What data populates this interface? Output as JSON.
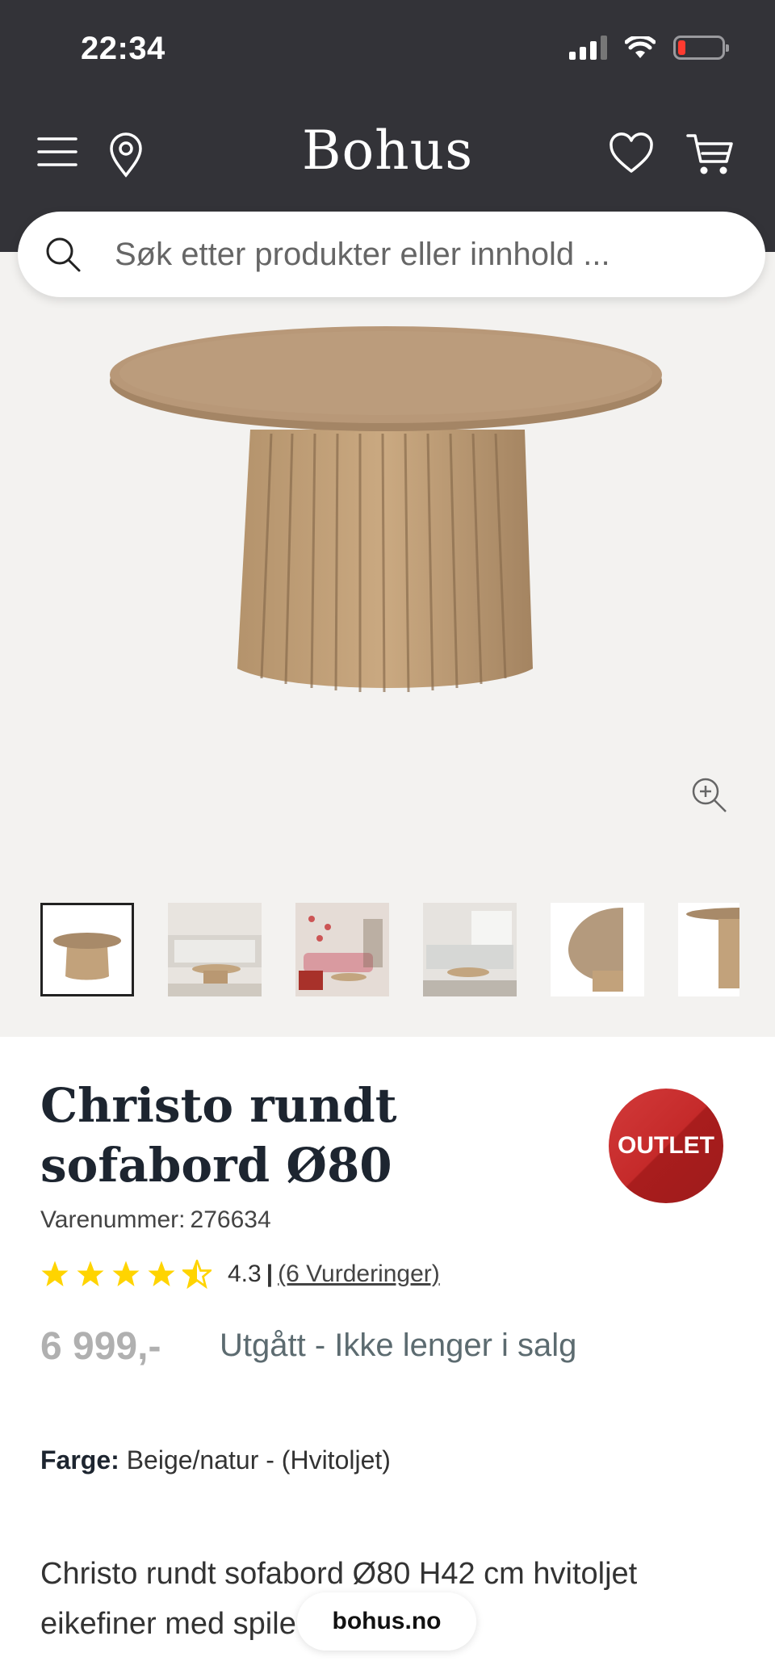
{
  "status_bar": {
    "time": "22:34"
  },
  "header": {
    "logo": "Bohus",
    "icons": [
      "menu-icon",
      "location-pin-icon",
      "heart-icon",
      "cart-icon"
    ]
  },
  "search": {
    "placeholder": "Søk etter produkter eller innhold ..."
  },
  "gallery": {
    "thumbnails": [
      "Christo table product",
      "Living room scene",
      "Pink sofa scene",
      "Grey sofa scene",
      "Tabletop close-up",
      "Table side view"
    ],
    "active_index": 0
  },
  "product": {
    "title": "Christo rundt sofabord Ø80",
    "badge": "OUTLET",
    "sku_label": "Varenummer:",
    "sku": "276634",
    "rating": "4.3",
    "rating_value": 4.3,
    "rating_max": 5,
    "rating_separator": "|",
    "reviews": "(6 Vurderinger)",
    "price": "6 999,-",
    "availability": "Utgått - Ikke lenger i salg",
    "color_label": "Farge:",
    "color_value": "Beige/natur - (Hvitoljet)",
    "description": "Christo rundt sofabord Ø80 H42 cm hvitoljet eikefiner med spile"
  },
  "browser": {
    "url": "bohus.no"
  },
  "colors": {
    "header_bg": "#333338",
    "star": "#ffd400",
    "badge": "#c52a2a",
    "gallery_bg": "#f3f2f0"
  }
}
